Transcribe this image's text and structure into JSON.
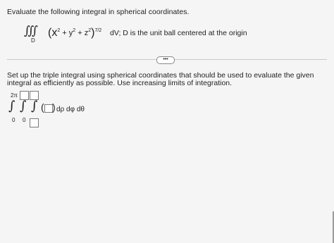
{
  "problem": {
    "prompt": "Evaluate the following integral in spherical coordinates.",
    "integral_symbol": "∭",
    "region": "D",
    "integrand_open": "(x",
    "exp_x": "2",
    "plus_y": " + y",
    "exp_y": "2",
    "plus_z": " + z",
    "exp_z": "2",
    "integrand_close": ")",
    "power": "7/2",
    "description": "dV; D is the unit ball centered at the origin"
  },
  "more_button": {
    "label": "•••"
  },
  "instructions": "Set up the triple integral using spherical coordinates that should be used to evaluate the given integral as efficiently as possible. Use increasing limits of integration.",
  "answer": {
    "outer_upper": "2π",
    "outer_lower": "0",
    "middle_lower": "0",
    "integral_symbol": "∫",
    "open_paren": "(",
    "close_paren": ")",
    "differentials": "dρ dφ dθ"
  }
}
